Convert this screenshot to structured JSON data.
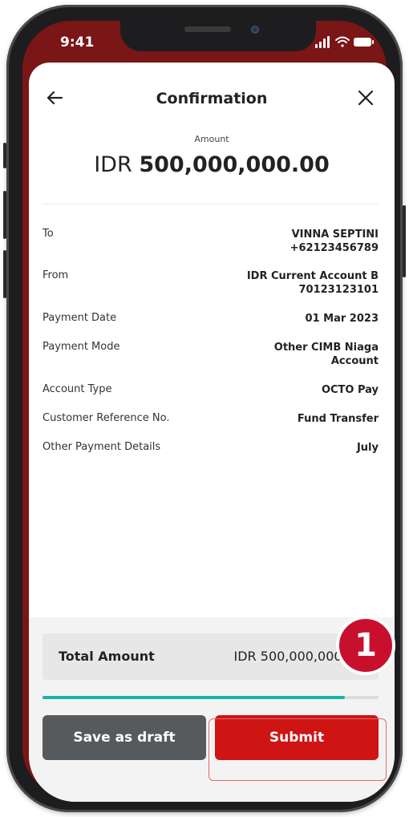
{
  "status_bar": {
    "time": "9:41"
  },
  "header": {
    "title": "Confirmation"
  },
  "amount": {
    "label": "Amount",
    "currency": "IDR",
    "value": "500,000,000.00"
  },
  "details": [
    {
      "label": "To",
      "value_line1": "VINNA SEPTINI",
      "value_line2": "+62123456789"
    },
    {
      "label": "From",
      "value_line1": "IDR Current Account B",
      "value_line2": "70123123101"
    },
    {
      "label": "Payment Date",
      "value_line1": "01 Mar 2023",
      "value_line2": ""
    },
    {
      "label": "Payment Mode",
      "value_line1": "Other CIMB Niaga",
      "value_line2": "Account"
    },
    {
      "label": "Account Type",
      "value_line1": "OCTO Pay",
      "value_line2": ""
    },
    {
      "label": "Customer Reference No.",
      "value_line1": "Fund Transfer",
      "value_line2": ""
    },
    {
      "label": "Other Payment Details",
      "value_line1": "July",
      "value_line2": ""
    }
  ],
  "total": {
    "label": "Total Amount",
    "value": "IDR 500,000,000.00"
  },
  "progress": {
    "fraction": 0.9
  },
  "buttons": {
    "save_draft": "Save as draft",
    "submit": "Submit"
  },
  "annotation": {
    "step": "1"
  },
  "colors": {
    "brand_red": "#cf1414",
    "accent_teal": "#18b3a8",
    "draft_gray": "#575a5d"
  },
  "icons": {
    "back": "arrow-left-icon",
    "close": "close-icon"
  }
}
